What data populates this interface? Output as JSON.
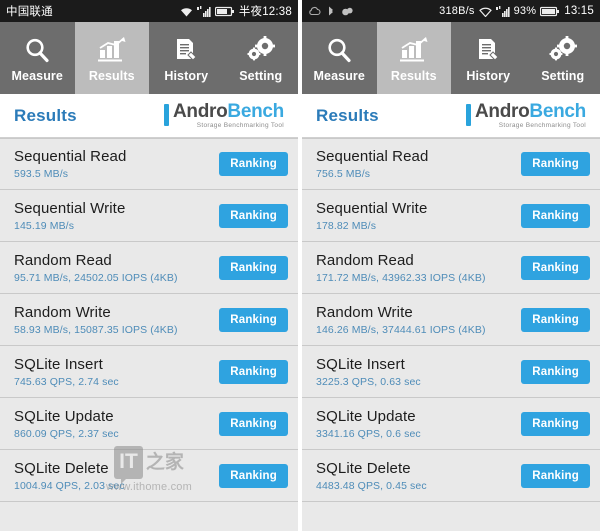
{
  "screens": [
    {
      "id": "left",
      "statusbar": {
        "carrier": "中国联通",
        "net_speed": "",
        "battery_percent": "",
        "clock": "半夜12:38",
        "icons": [
          "wifi-icon",
          "signal-icon",
          "battery-icon"
        ]
      },
      "tabs": [
        {
          "label": "Measure",
          "icon": "search-icon",
          "active": false
        },
        {
          "label": "Results",
          "icon": "bar-chart-icon",
          "active": true
        },
        {
          "label": "History",
          "icon": "document-pencil-icon",
          "active": false
        },
        {
          "label": "Setting",
          "icon": "gears-icon",
          "active": false
        }
      ],
      "header": {
        "title": "Results",
        "brand_first": "Andro",
        "brand_second": "Bench",
        "brand_sub": "Storage Benchmarking Tool"
      },
      "rows": [
        {
          "title": "Sequential Read",
          "value": "593.5 MB/s",
          "button": "Ranking"
        },
        {
          "title": "Sequential Write",
          "value": "145.19 MB/s",
          "button": "Ranking"
        },
        {
          "title": "Random Read",
          "value": "95.71 MB/s, 24502.05 IOPS (4KB)",
          "button": "Ranking"
        },
        {
          "title": "Random Write",
          "value": "58.93 MB/s, 15087.35 IOPS (4KB)",
          "button": "Ranking"
        },
        {
          "title": "SQLite Insert",
          "value": "745.63 QPS, 2.74 sec",
          "button": "Ranking"
        },
        {
          "title": "SQLite Update",
          "value": "860.09 QPS, 2.37 sec",
          "button": "Ranking"
        },
        {
          "title": "SQLite Delete",
          "value": "1004.94 QPS, 2.03 sec",
          "button": "Ranking"
        }
      ],
      "watermark": {
        "mark": "IT",
        "cn": "之家",
        "url": "www.ithome.com",
        "visible": true
      }
    },
    {
      "id": "right",
      "statusbar": {
        "carrier": "",
        "net_speed": "318B/s",
        "battery_percent": "93%",
        "clock": "13:15",
        "icons": [
          "cloud-icon",
          "bluetooth-icon",
          "notification-icon",
          "wifi-icon",
          "signal-icon",
          "battery-icon"
        ]
      },
      "tabs": [
        {
          "label": "Measure",
          "icon": "search-icon",
          "active": false
        },
        {
          "label": "Results",
          "icon": "bar-chart-icon",
          "active": true
        },
        {
          "label": "History",
          "icon": "document-pencil-icon",
          "active": false
        },
        {
          "label": "Setting",
          "icon": "gears-icon",
          "active": false
        }
      ],
      "header": {
        "title": "Results",
        "brand_first": "Andro",
        "brand_second": "Bench",
        "brand_sub": "Storage Benchmarking Tool"
      },
      "rows": [
        {
          "title": "Sequential Read",
          "value": "756.5 MB/s",
          "button": "Ranking"
        },
        {
          "title": "Sequential Write",
          "value": "178.82 MB/s",
          "button": "Ranking"
        },
        {
          "title": "Random Read",
          "value": "171.72 MB/s, 43962.33 IOPS (4KB)",
          "button": "Ranking"
        },
        {
          "title": "Random Write",
          "value": "146.26 MB/s, 37444.61 IOPS (4KB)",
          "button": "Ranking"
        },
        {
          "title": "SQLite Insert",
          "value": "3225.3 QPS, 0.63 sec",
          "button": "Ranking"
        },
        {
          "title": "SQLite Update",
          "value": "3341.16 QPS, 0.6 sec",
          "button": "Ranking"
        },
        {
          "title": "SQLite Delete",
          "value": "4483.48 QPS, 0.45 sec",
          "button": "Ranking"
        }
      ],
      "watermark": {
        "mark": "",
        "cn": "",
        "url": "",
        "visible": false
      }
    }
  ],
  "colors": {
    "accent_blue": "#2fa3e0",
    "title_blue": "#2b7bb9",
    "value_blue": "#4e8cb8",
    "tabbar_gray": "#6d6d6d",
    "tab_active_gray": "#bcbcbc",
    "list_bg": "#e9e9e9",
    "statusbar_black": "#1b1b1b"
  }
}
